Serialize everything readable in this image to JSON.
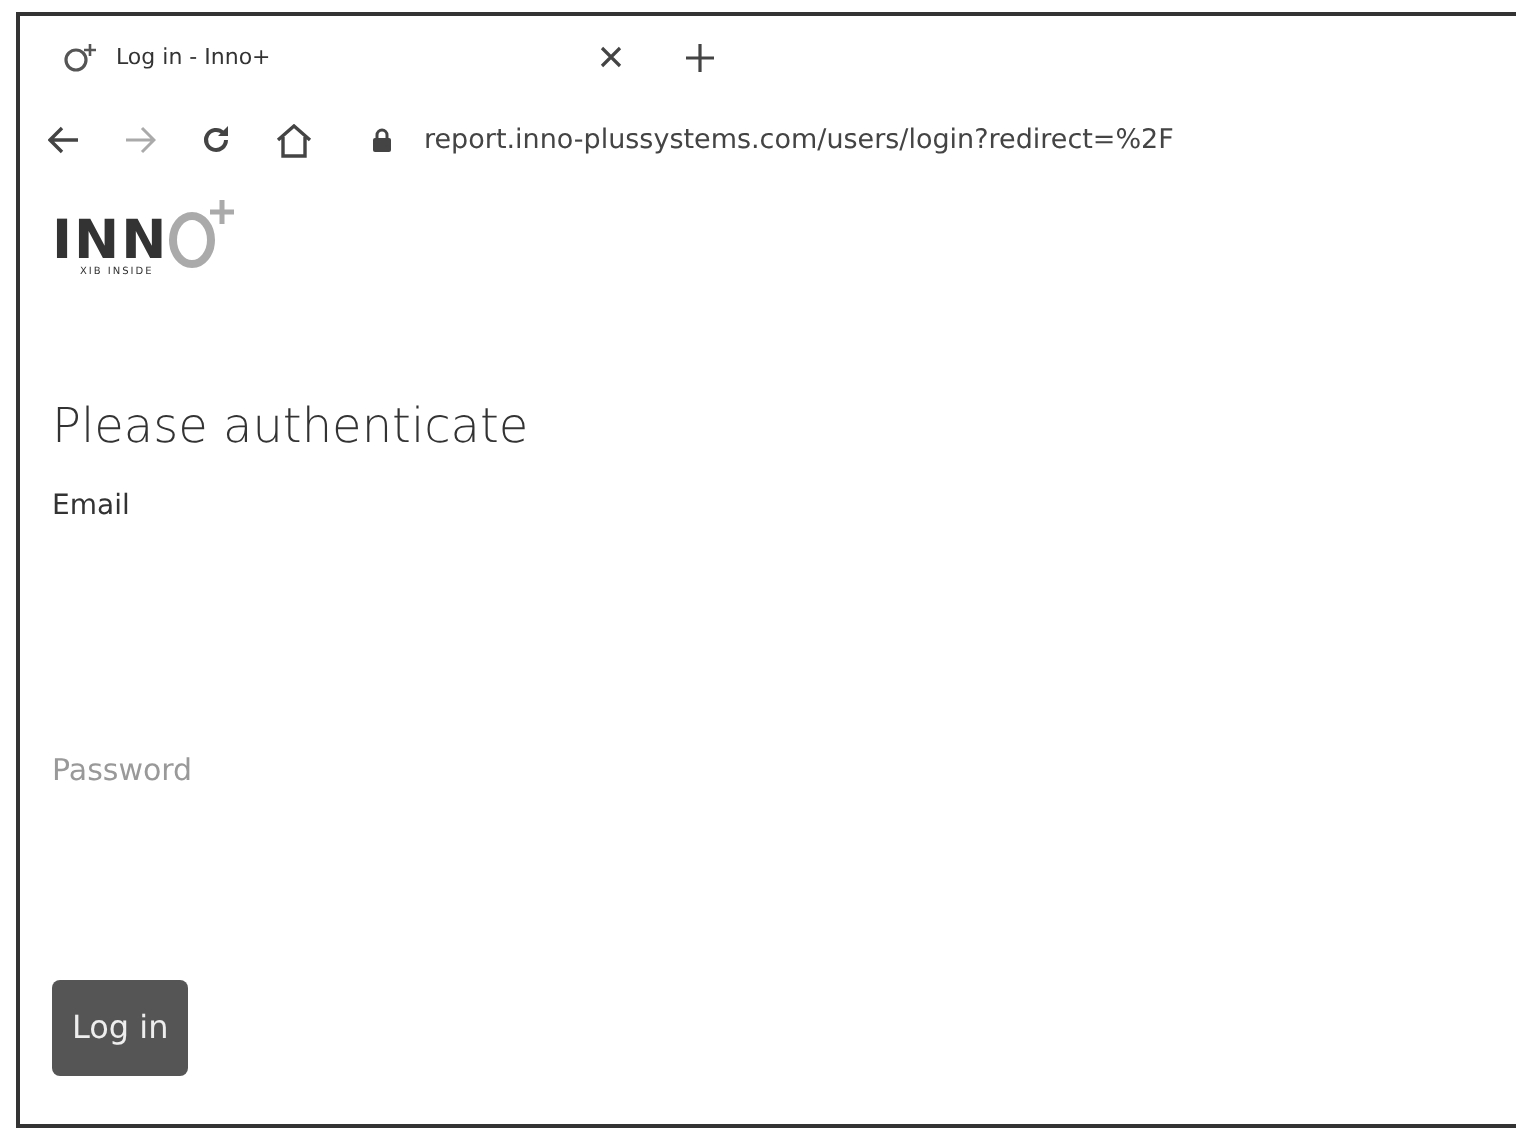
{
  "browser": {
    "tab": {
      "title": "Log in - Inno+",
      "selected": true
    },
    "address": "report.inno-plussystems.com/users/login?redirect=%2F"
  },
  "logo": {
    "text": "INN",
    "tagline": "XIB INSIDE"
  },
  "heading": "Please authenticate",
  "fields": [
    {
      "label": "Email",
      "kind": "labeled"
    },
    {
      "placeholder": "Password",
      "kind": "placeholder"
    }
  ],
  "button": "Log in"
}
